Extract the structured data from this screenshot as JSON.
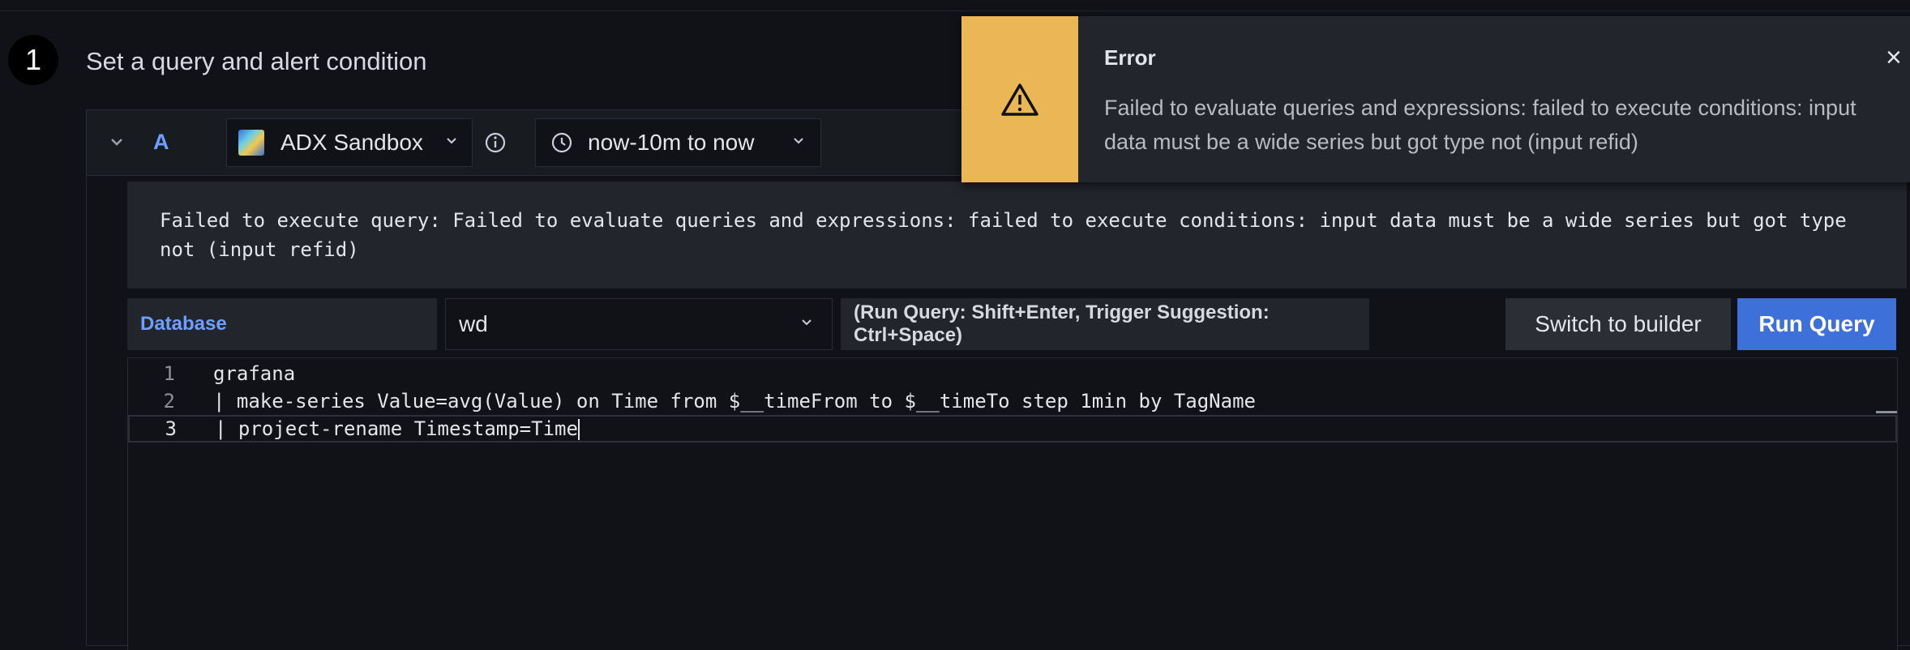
{
  "step": {
    "number": "1",
    "title": "Set a query and alert condition"
  },
  "query": {
    "ref_id": "A",
    "datasource": "ADX Sandbox",
    "time_range": "now-10m to now",
    "error_text": "Failed to execute query: Failed to evaluate queries and expressions: failed to execute conditions: input data must be a wide series but got type not (input refid)",
    "database_label": "Database",
    "database_value": "wd",
    "hint": "(Run Query: Shift+Enter, Trigger Suggestion: Ctrl+Space)",
    "switch_builder_label": "Switch to builder",
    "run_query_label": "Run Query",
    "code_lines": [
      {
        "num": "1",
        "text": "grafana"
      },
      {
        "num": "2",
        "text": "| make-series Value=avg(Value) on Time from $__timeFrom to $__timeTo step 1min by TagName"
      },
      {
        "num": "3",
        "text": "| project-rename Timestamp=Time"
      }
    ]
  },
  "toast": {
    "title": "Error",
    "message": "Failed to evaluate queries and expressions: failed to execute conditions: input data must be a wide series but got type not (input refid)",
    "close_symbol": "×",
    "accent_color": "#ebb655"
  }
}
